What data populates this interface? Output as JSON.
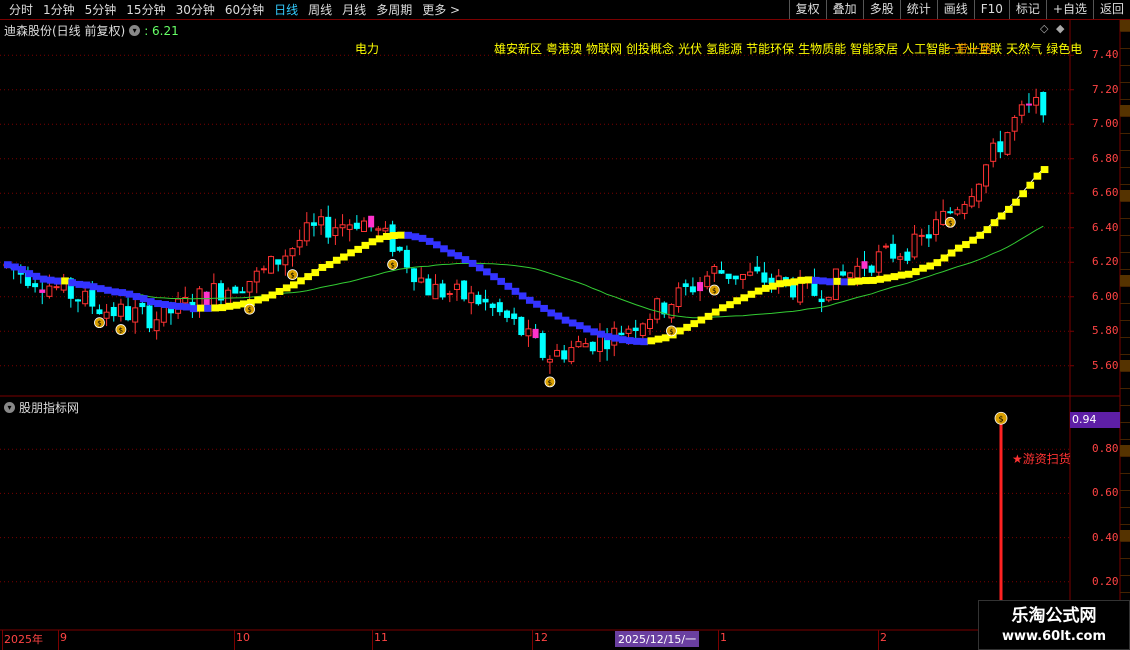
{
  "toolbar": {
    "periods": [
      "分时",
      "1分钟",
      "5分钟",
      "15分钟",
      "30分钟",
      "60分钟",
      "日线",
      "周线",
      "月线",
      "多周期",
      "更多"
    ],
    "more_arrow": ">",
    "right_buttons": [
      "复权",
      "叠加",
      "多股",
      "统计",
      "画线",
      "F10",
      "标记",
      "+自选",
      "返回"
    ]
  },
  "main_chart": {
    "title": "迪森股份(日线 前复权)",
    "title_value": ": 6.21",
    "menu_icon": "chevron-down-icon",
    "concept_left": "电力",
    "concepts_right": [
      "雄安新区",
      "粤港澳",
      "物联网",
      "创投概念",
      "光伏",
      "氢能源",
      "节能环保",
      "生物质能",
      "智能家居",
      "人工智能",
      "工业互联",
      "天然气",
      "绿色电"
    ],
    "overlay_concept": "一带一路",
    "price_ticks": [
      "7.40",
      "7.20",
      "7.00",
      "6.80",
      "6.60",
      "6.40",
      "6.20",
      "6.00",
      "5.80",
      "5.60"
    ]
  },
  "sub_chart": {
    "title": "股朋指标网",
    "current_value": "0.94",
    "ticks": [
      "0.80",
      "0.60",
      "0.40",
      "0.20"
    ],
    "annotation": "★游资扫货"
  },
  "date_axis": {
    "labels": [
      "2025年",
      "9",
      "10",
      "11",
      "12",
      "2025/12/15/一",
      "1",
      "2"
    ]
  },
  "watermark": {
    "line1": "乐淘公式网",
    "line2": "www.60lt.com"
  },
  "colors": {
    "up": "#ff3333",
    "down": "#00ffff",
    "ma_yellow": "#ffff00",
    "ma_blue": "#3333ff",
    "ma_green": "#33cc33",
    "ma_white": "#ffffff",
    "magenta": "#ff33cc",
    "grid": "#7a0000"
  }
}
